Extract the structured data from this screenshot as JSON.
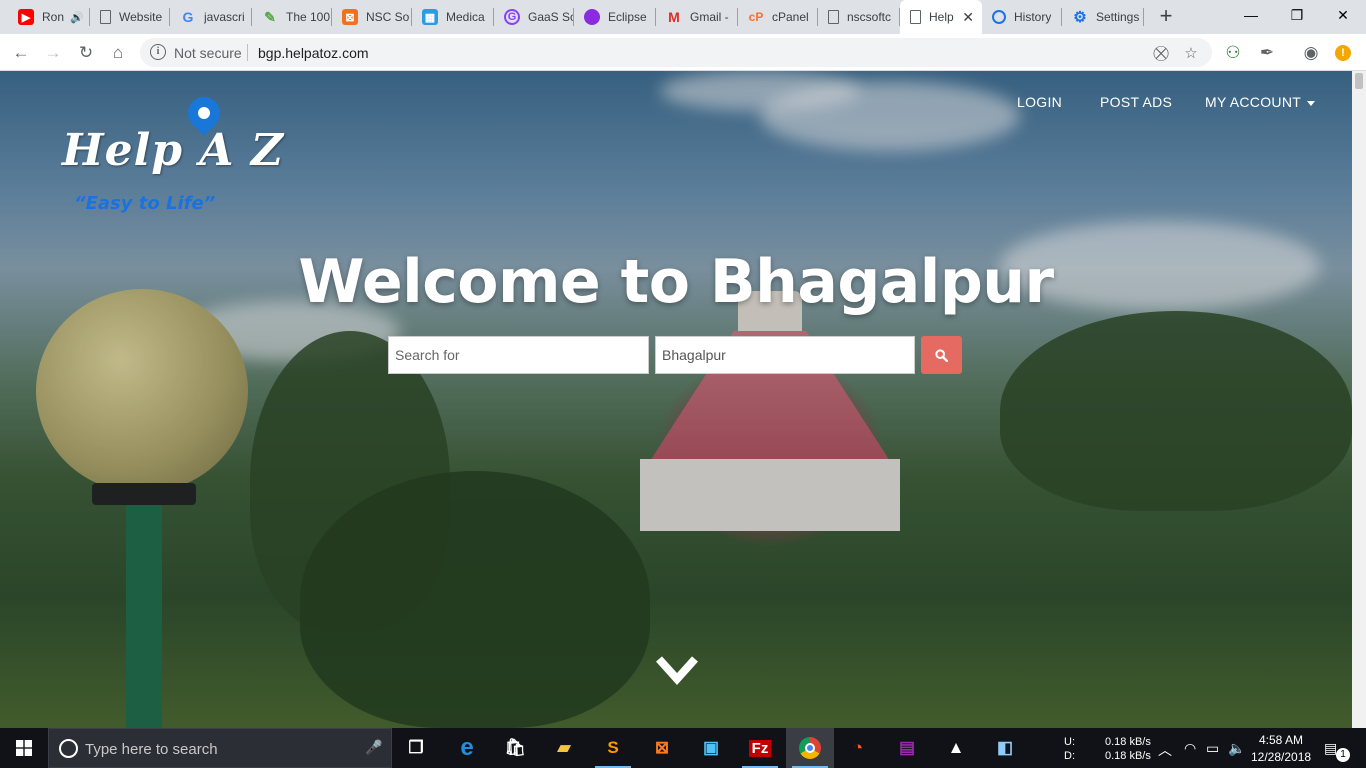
{
  "browser": {
    "tabs": [
      {
        "title": "Ron",
        "favicon": "youtube-icon",
        "color": "#ff0000",
        "audio": true
      },
      {
        "title": "Website",
        "favicon": "page-icon",
        "color": "#5f6368"
      },
      {
        "title": "javascri",
        "favicon": "google-icon",
        "color": "#4285f4"
      },
      {
        "title": "The 100",
        "favicon": "leaf-icon",
        "color": "#58a84a"
      },
      {
        "title": "NSC So",
        "favicon": "xampp-icon",
        "color": "#f37021"
      },
      {
        "title": "Medica",
        "favicon": "grid-icon",
        "color": "#2d9be0"
      },
      {
        "title": "GaaS Sc",
        "favicon": "gaas-icon",
        "color": "#8a3ffc"
      },
      {
        "title": "Eclipse",
        "favicon": "eclipse-icon",
        "color": "#8a2be2"
      },
      {
        "title": "Gmail -",
        "favicon": "gmail-icon",
        "color": "#d93025"
      },
      {
        "title": "cPanel",
        "favicon": "cpanel-icon",
        "color": "#ff6c2c"
      },
      {
        "title": "nscsoftc",
        "favicon": "page-icon",
        "color": "#5f6368"
      },
      {
        "title": "Help",
        "favicon": "page-icon",
        "color": "#5f6368",
        "active": true
      },
      {
        "title": "History",
        "favicon": "history-icon",
        "color": "#1a73e8"
      },
      {
        "title": "Settings",
        "favicon": "settings-icon",
        "color": "#1a73e8"
      }
    ],
    "new_tab_symbol": "+",
    "window": {
      "minimize": "—",
      "maximize": "❐",
      "close": "✕"
    },
    "address": {
      "security_label": "Not secure",
      "url": "bgp.helpatoz.com"
    }
  },
  "site": {
    "logo": {
      "text": "Help A Z",
      "tagline": "“Easy to Life”"
    },
    "nav": {
      "login": "LOGIN",
      "post_ads": "POST ADS",
      "my_account": "MY ACCOUNT"
    },
    "hero": {
      "title": "Welcome to Bhagalpur",
      "search_placeholder": "Search for",
      "location_value": "Bhagalpur"
    },
    "colors": {
      "search_button": "#e46a62",
      "logo_blue": "#1a72e0"
    }
  },
  "taskbar": {
    "search_placeholder": "Type here to search",
    "net_labels": [
      "U:",
      "D:"
    ],
    "net_speeds": [
      "0.18 kB/s",
      "0.18 kB/s"
    ],
    "time": "4:58 AM",
    "date": "12/28/2018",
    "notification_count": "1"
  }
}
